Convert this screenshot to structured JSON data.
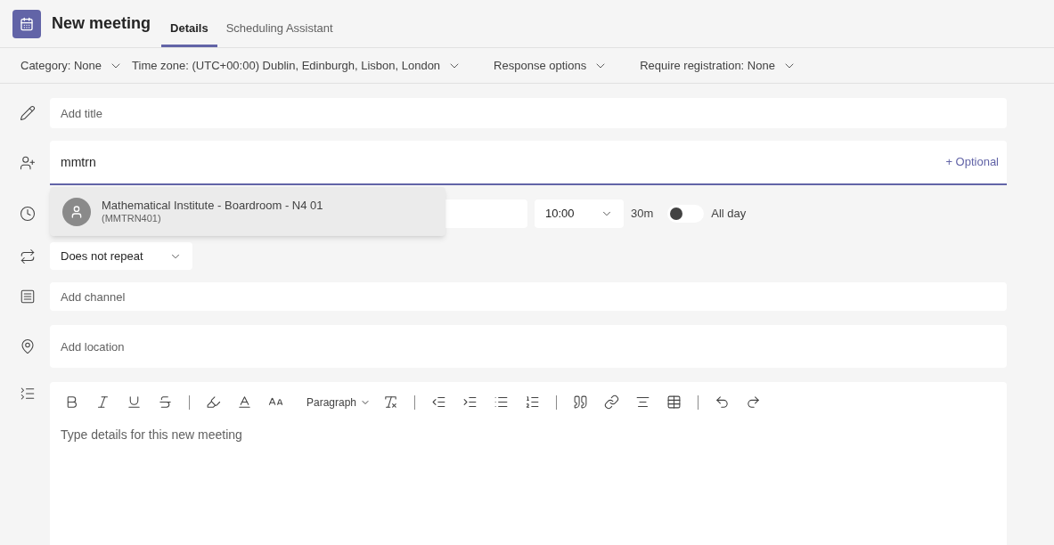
{
  "header": {
    "title": "New meeting",
    "tabs": [
      {
        "label": "Details",
        "selected": true
      },
      {
        "label": "Scheduling Assistant",
        "selected": false
      }
    ]
  },
  "options_bar": [
    "Category: None",
    "Time zone: (UTC+00:00) Dublin, Edinburgh, Lisbon, London",
    "Response options",
    "Require registration: None"
  ],
  "title_field": {
    "placeholder": "Add title"
  },
  "attendees_field": {
    "value": "mmtrn",
    "optional_link": "+ Optional"
  },
  "suggestion": {
    "name": "Mathematical Institute - Boardroom - N4 01",
    "id": "(MMTRN401)"
  },
  "time_row": {
    "end_time": "10:00",
    "duration": "30m",
    "all_day": {
      "label": "All day",
      "on": false
    }
  },
  "repeat": {
    "value": "Does not repeat"
  },
  "channel_field": {
    "placeholder": "Add channel"
  },
  "location_field": {
    "placeholder": "Add location"
  },
  "editor": {
    "paragraph_style": "Paragraph",
    "placeholder": "Type details for this new meeting"
  }
}
